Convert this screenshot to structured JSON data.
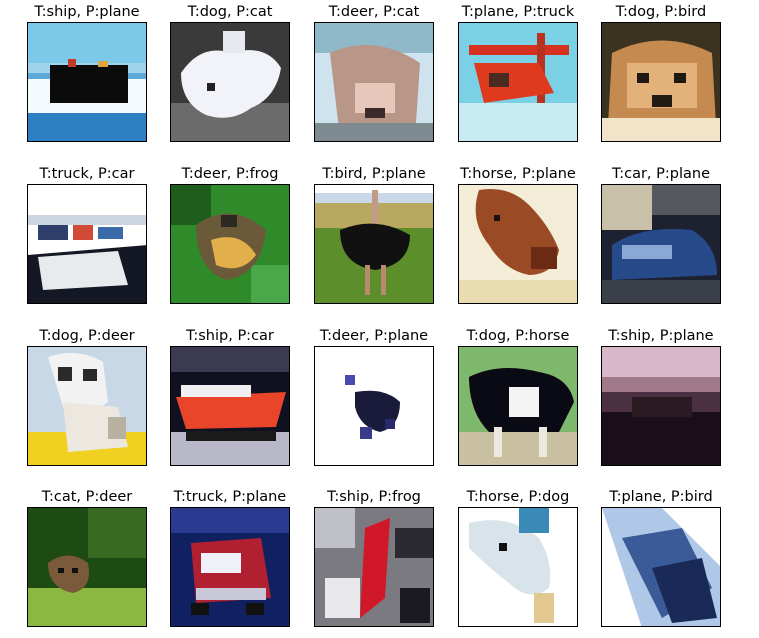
{
  "figure": {
    "panels": [
      {
        "label": "T:ship, P:plane",
        "subject": "ship"
      },
      {
        "label": "T:dog, P:cat",
        "subject": "dog"
      },
      {
        "label": "T:deer, P:cat",
        "subject": "deer"
      },
      {
        "label": "T:plane, P:truck",
        "subject": "plane"
      },
      {
        "label": "T:dog, P:bird",
        "subject": "dog"
      },
      {
        "label": "T:truck, P:car",
        "subject": "truck"
      },
      {
        "label": "T:deer, P:frog",
        "subject": "deer"
      },
      {
        "label": "T:bird, P:plane",
        "subject": "bird"
      },
      {
        "label": "T:horse, P:plane",
        "subject": "horse"
      },
      {
        "label": "T:car, P:plane",
        "subject": "car"
      },
      {
        "label": "T:dog, P:deer",
        "subject": "dog"
      },
      {
        "label": "T:ship, P:car",
        "subject": "ship"
      },
      {
        "label": "T:deer, P:plane",
        "subject": "deer"
      },
      {
        "label": "T:dog, P:horse",
        "subject": "dog"
      },
      {
        "label": "T:ship, P:plane",
        "subject": "ship"
      },
      {
        "label": "T:cat, P:deer",
        "subject": "cat"
      },
      {
        "label": "T:truck, P:plane",
        "subject": "truck"
      },
      {
        "label": "T:ship, P:frog",
        "subject": "ship"
      },
      {
        "label": "T:horse, P:dog",
        "subject": "horse"
      },
      {
        "label": "T:plane, P:bird",
        "subject": "plane"
      }
    ]
  }
}
